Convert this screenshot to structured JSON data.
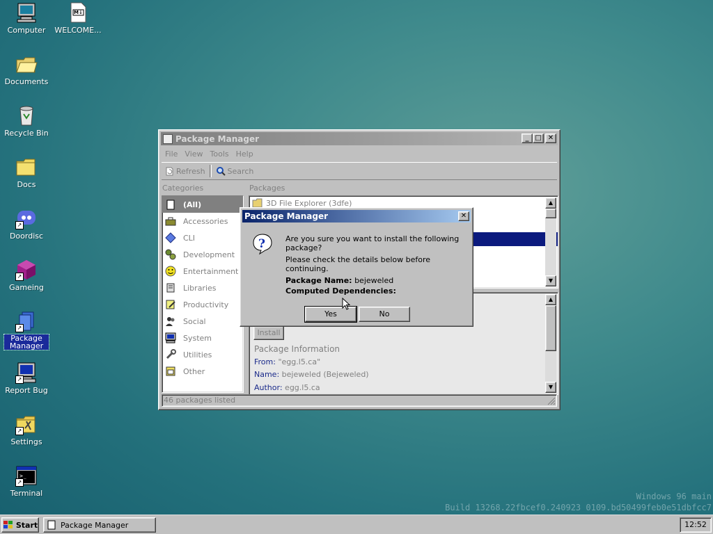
{
  "desktop": {
    "icons": [
      {
        "label": "Computer"
      },
      {
        "label": "WELCOME...",
        "badge": "M↓"
      },
      {
        "label": "Documents"
      },
      {
        "label": "Recycle Bin"
      },
      {
        "label": "Docs"
      },
      {
        "label": "Doordisc"
      },
      {
        "label": "Gameing"
      },
      {
        "label": "Package Manager"
      },
      {
        "label": "Report Bug"
      },
      {
        "label": "Settings"
      },
      {
        "label": "Terminal"
      }
    ],
    "watermark_line1": "Windows 96 main",
    "watermark_line2": "Build 13268.22fbcef0.240923 0109.bd50499feb0e51dbfcc7"
  },
  "window": {
    "title": "Package Manager",
    "menu": [
      "File",
      "View",
      "Tools",
      "Help"
    ],
    "toolbar": {
      "refresh": "Refresh",
      "search": "Search"
    },
    "categories_label": "Categories",
    "packages_label": "Packages",
    "categories": [
      {
        "label": "(All)"
      },
      {
        "label": "Accessories"
      },
      {
        "label": "CLI"
      },
      {
        "label": "Development"
      },
      {
        "label": "Entertainment"
      },
      {
        "label": "Libraries"
      },
      {
        "label": "Productivity"
      },
      {
        "label": "Social"
      },
      {
        "label": "System"
      },
      {
        "label": "Utilities"
      },
      {
        "label": "Other"
      }
    ],
    "packages": [
      {
        "label": "3D File Explorer (3dfe)"
      }
    ],
    "install_button": "Install",
    "package_info_label": "Package Information",
    "info": {
      "from_key": "From:",
      "from_val": "\"egg.l5.ca\"",
      "name_key": "Name:",
      "name_val": "bejeweled (Bejeweled)",
      "author_key": "Author:",
      "author_val": "egg.l5.ca"
    },
    "status": "46 packages listed"
  },
  "dialog": {
    "title": "Package Manager",
    "line1": "Are you sure you want to install the following package?",
    "line2": "Please check the details below before continuing.",
    "pkg_name_label": "Package Name:",
    "pkg_name_value": "bejeweled",
    "deps_label": "Computed Dependencies:",
    "yes": "Yes",
    "no": "No"
  },
  "taskbar": {
    "start": "Start",
    "task": "Package Manager",
    "clock": "12:52"
  }
}
